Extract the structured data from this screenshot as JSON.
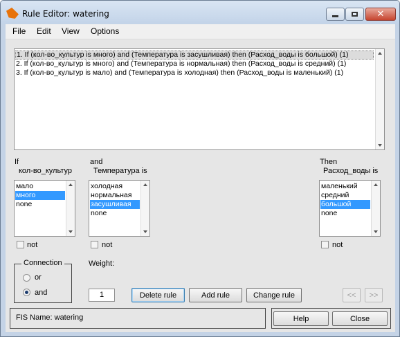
{
  "window": {
    "title": "Rule Editor: watering",
    "icon": "matlab-icon",
    "minimize_icon": "minimize-icon",
    "maximize_icon": "maximize-icon",
    "close_icon": "close-icon"
  },
  "menu": [
    "File",
    "Edit",
    "View",
    "Options"
  ],
  "rules": [
    {
      "text": "1. If (кол-во_культур is много) and (Температура is засушливая) then (Расход_воды is большой) (1)",
      "selected": true
    },
    {
      "text": "2. If (кол-во_культур is много) and (Температура is нормальная) then (Расход_воды is средний) (1)",
      "selected": false
    },
    {
      "text": "3. If (кол-во_культур is мало) and (Температура is холодная) then (Расход_воды is маленький) (1)",
      "selected": false
    }
  ],
  "antecedent1": {
    "connector": "If",
    "variable": "кол-во_культур",
    "items": [
      "мало",
      "много",
      "none"
    ],
    "selected": "много",
    "not_label": "not",
    "not_checked": false
  },
  "antecedent2": {
    "connector": "and",
    "variable": "Температура is",
    "items": [
      "холодная",
      "нормальная",
      "засушливая",
      "none"
    ],
    "selected": "засушливая",
    "not_label": "not",
    "not_checked": false
  },
  "consequent": {
    "connector": "Then",
    "variable": "Расход_воды is",
    "items": [
      "маленький",
      "средний",
      "большой",
      "none"
    ],
    "selected": "большой",
    "not_label": "not",
    "not_checked": false
  },
  "connection": {
    "title": "Connection",
    "options": [
      "or",
      "and"
    ],
    "selected": "and"
  },
  "weight": {
    "label": "Weight:",
    "value": "1"
  },
  "buttons": {
    "delete_rule": "Delete rule",
    "add_rule": "Add rule",
    "change_rule": "Change rule",
    "prev": "<<",
    "next": ">>",
    "help": "Help",
    "close": "Close"
  },
  "status": {
    "text": "FIS Name: watering"
  }
}
